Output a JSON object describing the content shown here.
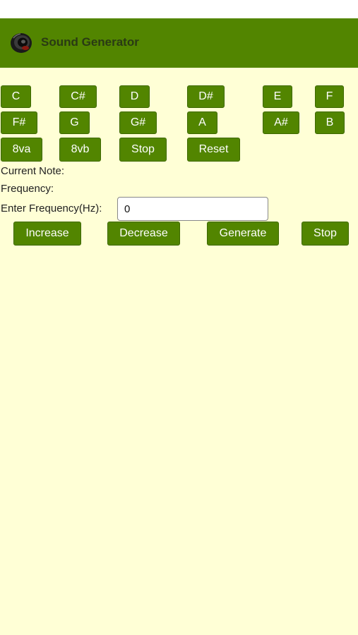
{
  "header": {
    "title": "Sound Generator",
    "logo_icon": "speaker-icon",
    "color": "#528500"
  },
  "notes": {
    "row1": [
      "C",
      "C#",
      "D",
      "D#",
      "E",
      "F"
    ],
    "row2": [
      "F#",
      "G",
      "G#",
      "A",
      "A#",
      "B"
    ]
  },
  "octave": {
    "up_label": "8va",
    "down_label": "8vb",
    "stop_label": "Stop",
    "reset_label": "Reset"
  },
  "info": {
    "current_note_label": "Current Note:",
    "frequency_label": "Frequency:"
  },
  "frequency_input": {
    "label": "Enter Frequency(Hz):",
    "value": "0"
  },
  "controls": {
    "increase_label": "Increase",
    "decrease_label": "Decrease",
    "generate_label": "Generate",
    "stop_label": "Stop"
  },
  "colors": {
    "background": "#ffffd6",
    "button": "#528500",
    "button_text": "#ffffff"
  }
}
